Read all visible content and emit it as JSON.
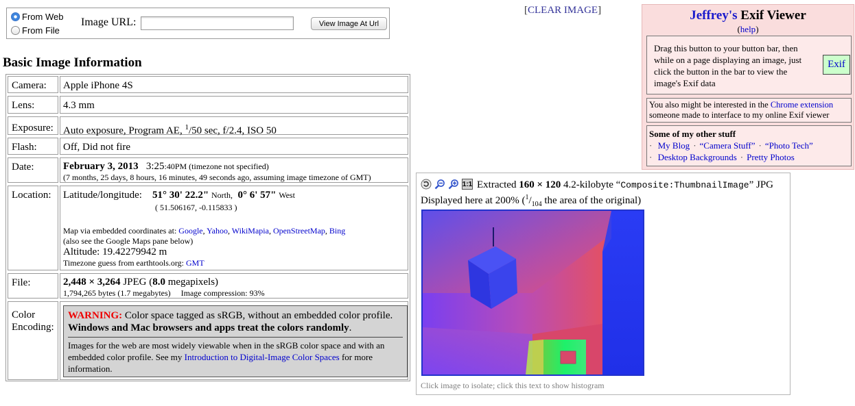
{
  "form": {
    "source_options": [
      {
        "label": "From Web",
        "selected": true
      },
      {
        "label": "From File",
        "selected": false
      }
    ],
    "url_label": "Image URL:",
    "url_value": "",
    "view_button": "View Image At Url"
  },
  "clear_link": {
    "open": "[",
    "label": "CLEAR IMAGE",
    "close": "]"
  },
  "info": {
    "heading": "Basic Image Information",
    "camera": {
      "label": "Camera:",
      "value": "Apple iPhone 4S"
    },
    "lens": {
      "label": "Lens:",
      "value": "4.3 mm"
    },
    "exposure": {
      "label": "Exposure:",
      "prefix": "Auto exposure, Program AE, ",
      "shutter_num": "1",
      "shutter_den": "/50 sec, f/2.4, ISO 50"
    },
    "flash": {
      "label": "Flash:",
      "value": "Off, Did not fire"
    },
    "date": {
      "label": "Date:",
      "date": "February 3, 2013",
      "time_main": "3:25",
      "time_rest": ":40PM (timezone not specified)",
      "relative": "(7 months, 25 days, 8 hours, 16 minutes, 49 seconds ago, assuming image timezone of GMT)"
    },
    "location": {
      "label": "Location:",
      "latlon_label": "Latitude/longitude:",
      "lat_main": "51° 30' 22.2\"",
      "lat_dir": "North,",
      "lon_main": "0° 6' 57\"",
      "lon_dir": "West",
      "decimal": "( 51.506167, -0.115833 )",
      "map_text": "Map via embedded coordinates at:",
      "map_links": [
        "Google",
        "Yahoo",
        "WikiMapia",
        "OpenStreetMap",
        "Bing"
      ],
      "maps_pane_note": "(also see the Google Maps pane below)",
      "altitude": "Altitude: 19.42279942 m",
      "timezone_text": "Timezone guess from earthtools.org:",
      "timezone_link": "GMT"
    },
    "file": {
      "label": "File:",
      "dimensions": "2,448 × 3,264",
      "format": " JPEG (",
      "megapixels": "8.0",
      "megapixels_unit": " megapixels)",
      "bytes": "1,794,265 bytes (1.7 megabytes)",
      "compression": "Image compression: 93%"
    },
    "color": {
      "label_line1": "Color",
      "label_line2": "Encoding:",
      "warning_title": "WARNING:",
      "warning_text": " Color space tagged as sRGB, without an embedded color profile. ",
      "warning_bold": "Windows and Mac browsers and apps treat the colors randomly",
      "warning_end": ".",
      "more_text": "Images for the web are most widely viewable when in the sRGB color space and with an embedded color profile. See my ",
      "more_link": "Introduction to Digital-Image Color Spaces",
      "more_end": " for more information."
    }
  },
  "side": {
    "owner": "Jeffrey's",
    "title_rest": " Exif Viewer",
    "help_open": "(",
    "help": "help",
    "help_close": ")",
    "drag_text": "Drag this button to your button bar, then while on a page displaying an image, just click the button in the bar to view the image's Exif data",
    "exif_button": "Exif",
    "chrome_text_pre": "You also might be interested in the ",
    "chrome_link": "Chrome extension",
    "chrome_text_post": " someone made to interface to my online Exif viewer",
    "stuff_title": "Some of my other stuff",
    "stuff_links": [
      "My Blog",
      "“Camera Stuff”",
      "“Photo Tech”",
      "Desktop Backgrounds",
      "Pretty Photos"
    ]
  },
  "thumb": {
    "tools": [
      "rotate-icon",
      "zoom-out-icon",
      "zoom-in-icon",
      "actual-size-icon"
    ],
    "actual_size_label": "1:1",
    "extracted": "Extracted ",
    "size": "160 × 120",
    "kb": " 4.2-kilobyte “",
    "tag": "Composite:ThumbnailImage",
    "jpg": "” JPG",
    "displayed": "Displayed here at 200% (",
    "frac_num": "1",
    "frac_den": "104",
    "displayed_end": " the area of the original)",
    "caption": "Click image to isolate; click this text to show histogram"
  }
}
